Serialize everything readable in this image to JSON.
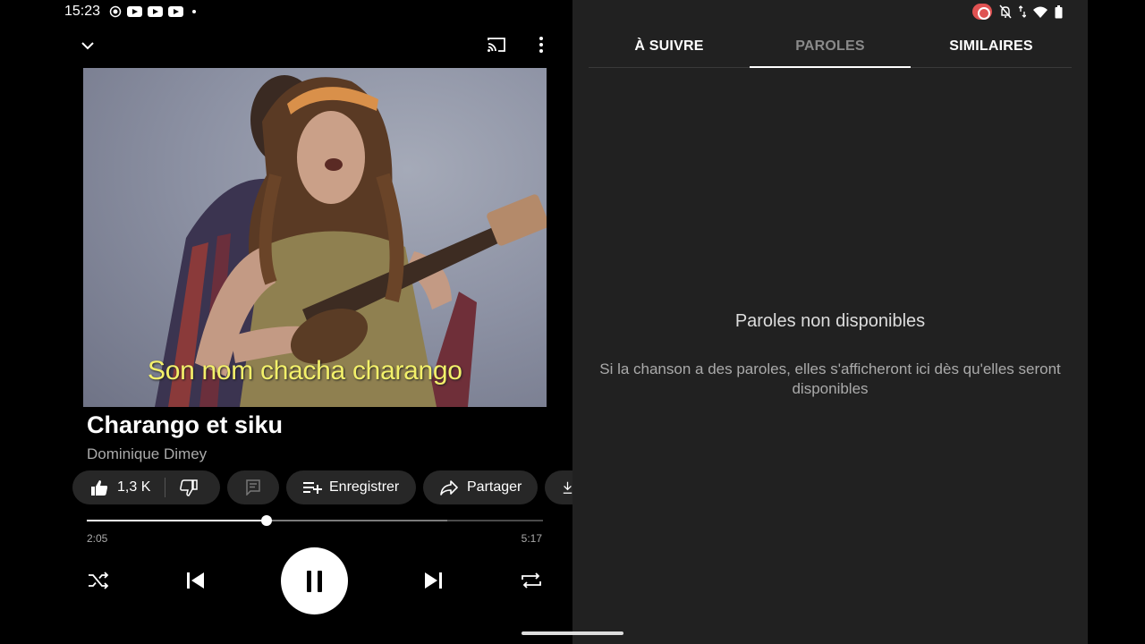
{
  "status_bar": {
    "time": "15:23"
  },
  "video": {
    "caption": "Son nom chacha charango"
  },
  "song": {
    "title": "Charango et siku",
    "artist": "Dominique Dimey"
  },
  "actions": {
    "like_count": "1,3 K",
    "save_label": "Enregistrer",
    "share_label": "Partager"
  },
  "player": {
    "elapsed": "2:05",
    "duration": "5:17",
    "progress_fraction": 0.394,
    "buffered_fraction": 0.79
  },
  "tabs": [
    {
      "label": "À SUIVRE",
      "active": false
    },
    {
      "label": "PAROLES",
      "active": true
    },
    {
      "label": "SIMILAIRES",
      "active": false
    }
  ],
  "lyrics": {
    "title": "Paroles non disponibles",
    "message": "Si la chanson a des paroles, elles s'afficheront ici dès qu'elles seront disponibles"
  },
  "colors": {
    "tab_active": "#8a8a8a",
    "tab_inactive": "#ffffff",
    "caption": "#f3f06a",
    "right_pane_bg": "#212121"
  }
}
